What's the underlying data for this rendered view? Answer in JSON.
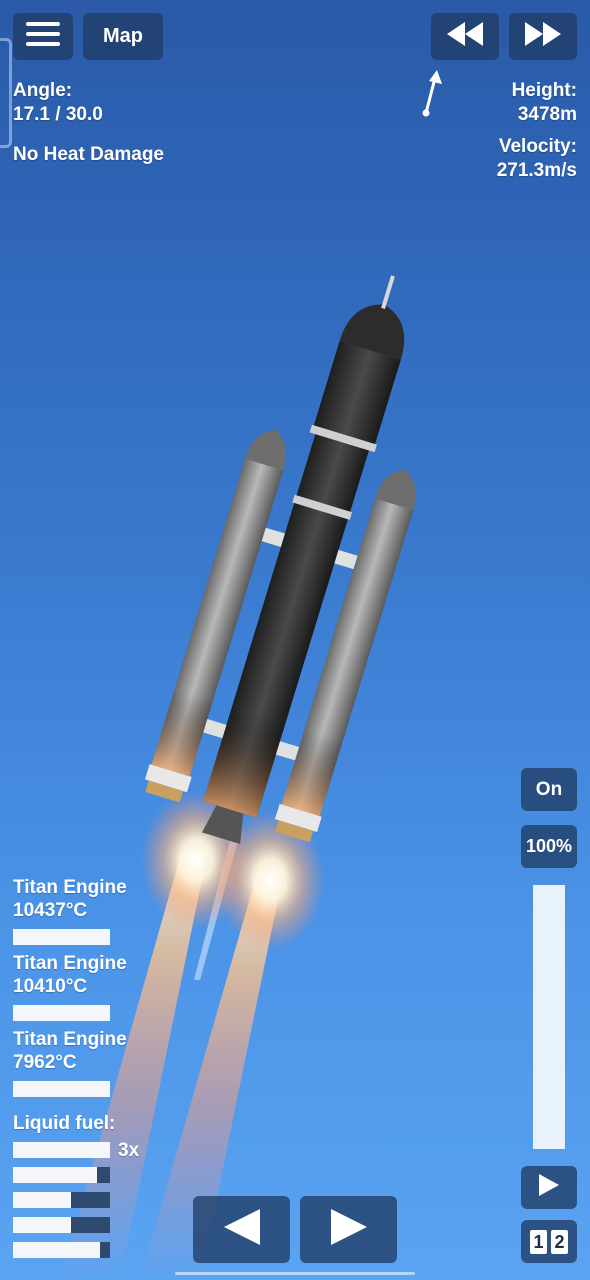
{
  "top_bar": {
    "map_label": "Map"
  },
  "left_info": {
    "angle_label": "Angle:",
    "angle_value": "17.1 / 30.0",
    "heat_status": "No Heat Damage"
  },
  "right_info": {
    "height_label": "Height:",
    "height_value": "3478m",
    "velocity_label": "Velocity:",
    "velocity_value": "271.3m/s"
  },
  "engines": [
    {
      "name": "Titan Engine",
      "temp": "10437°C",
      "heat_level": 1.0
    },
    {
      "name": "Titan Engine",
      "temp": "10410°C",
      "heat_level": 1.0
    },
    {
      "name": "Titan Engine",
      "temp": "7962°C",
      "heat_level": 1.0
    }
  ],
  "fuel": {
    "label": "Liquid fuel:",
    "multiplier": "3x",
    "levels": [
      1.0,
      0.87,
      0.6,
      0.6,
      0.9
    ]
  },
  "throttle": {
    "toggle_label": "On",
    "percent_label": "100%",
    "level": 1.0
  },
  "stage_buttons": {
    "first": "1",
    "second": "2"
  },
  "icons": {
    "menu": "hamburger-icon",
    "rewind": "rewind-icon",
    "fast_forward": "fast-forward-icon",
    "direction": "direction-arrow-icon",
    "play": "play-icon",
    "rotate_left": "rotate-left-icon",
    "rotate_right": "rotate-right-icon"
  },
  "colors": {
    "sky_top": "#2a5aa8",
    "sky_bottom": "#5aa4f2",
    "button_bg": "#203c64"
  }
}
